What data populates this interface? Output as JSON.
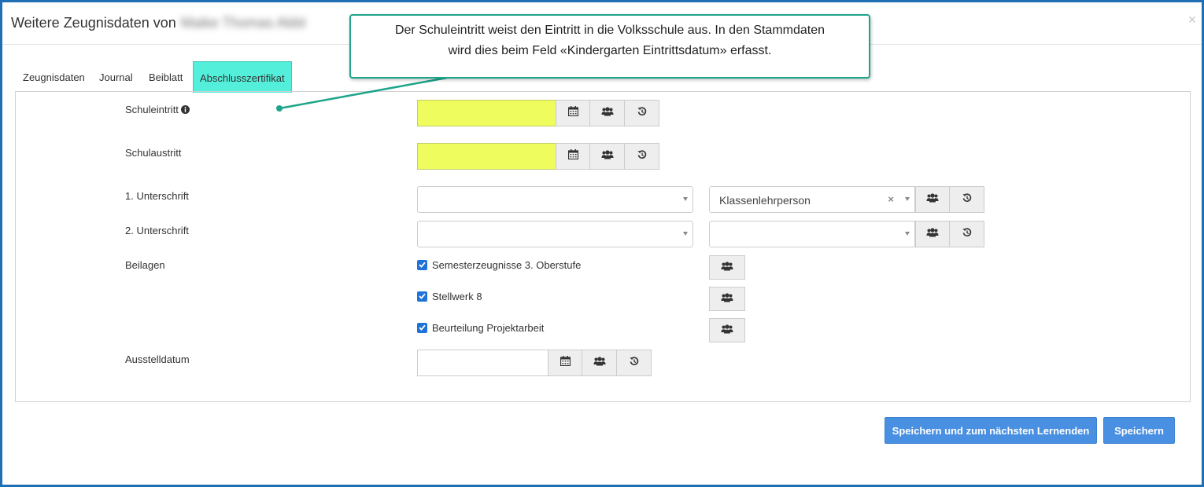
{
  "window": {
    "title_prefix": "Weitere Zeugnisdaten von",
    "student_name": "Maike Thomas Abbt",
    "close_label": "×"
  },
  "tabs": [
    {
      "label": "Zeugnisdaten",
      "active": false
    },
    {
      "label": "Journal",
      "active": false
    },
    {
      "label": "Beiblatt",
      "active": false
    },
    {
      "label": "Abschlusszertifikat",
      "active": true
    }
  ],
  "form": {
    "schuleintritt": {
      "label": "Schuleintritt",
      "value": "",
      "highlight": "#eefc5d"
    },
    "schulaustritt": {
      "label": "Schulaustritt",
      "value": "",
      "highlight": "#eefc5d"
    },
    "unterschrift1": {
      "label": "1. Unterschrift",
      "left_value": "",
      "right_value": "Klassenlehrperson",
      "clear_label": "×"
    },
    "unterschrift2": {
      "label": "2. Unterschrift",
      "left_value": "",
      "right_value": ""
    },
    "beilagen": {
      "label": "Beilagen",
      "items": [
        {
          "label": "Semesterzeugnisse 3. Oberstufe",
          "checked": true
        },
        {
          "label": "Stellwerk 8",
          "checked": true
        },
        {
          "label": "Beurteilung Projektarbeit",
          "checked": true
        }
      ]
    },
    "ausstelldatum": {
      "label": "Ausstelldatum",
      "value": ""
    }
  },
  "icons": {
    "calendar": "calendar-icon",
    "group": "users-icon",
    "reset": "history-icon",
    "info": "info-circle-icon"
  },
  "buttons": {
    "save_next": "Speichern und zum nächsten Lernenden",
    "save": "Speichern"
  },
  "callout": {
    "line1": "Der Schuleintritt weist den Eintritt in die Volksschule aus. In den Stammdaten",
    "line2": "wird dies beim Feld «Kindergarten Eintrittsdatum» erfasst."
  },
  "colors": {
    "frame": "#1f6fb5",
    "active_tab": "#53efda",
    "primary_button": "#4a90e2",
    "callout_border": "#1ea58b",
    "checkbox": "#1f72d8"
  }
}
